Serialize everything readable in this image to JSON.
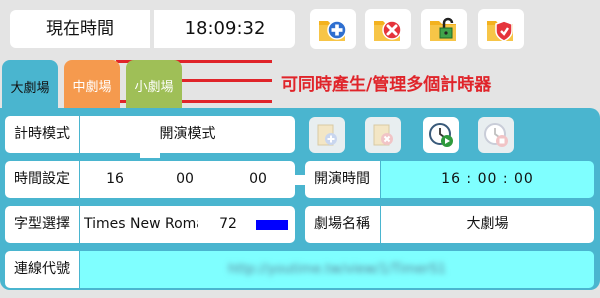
{
  "clock": {
    "label": "現在時間",
    "time": "18:09:32"
  },
  "toolbar": {
    "add_icon": "folder-plus-icon",
    "delete_icon": "folder-delete-icon",
    "unlock_icon": "folder-unlock-icon",
    "shield_icon": "folder-shield-icon"
  },
  "tabs": [
    {
      "label": "大劇場",
      "color": "#4ab5cf",
      "active": true
    },
    {
      "label": "中劇場",
      "color": "#f59a4e",
      "active": false
    },
    {
      "label": "小劇場",
      "color": "#9fbf57",
      "active": false
    }
  ],
  "annotation": "可同時產生/管理多個計時器",
  "annotation_color": "#e0242a",
  "form": {
    "mode_label": "計時模式",
    "mode_value": "開演模式",
    "time_label": "時間設定",
    "time_h": "16",
    "time_m": "00",
    "time_s": "00",
    "start_label": "開演時間",
    "start_value": "16 : 00 : 00",
    "font_label": "字型選擇",
    "font_value": "Times New Roman",
    "font_size": "72",
    "font_color": "#0000ff",
    "venue_label": "劇場名稱",
    "venue_value": "大劇場",
    "link_label": "連線代號",
    "link_value": "http://youtime.tw/view/1/TimerS1"
  },
  "panel_buttons": {
    "add_icon": "doc-add-icon",
    "delete_icon": "doc-delete-icon",
    "clock_play_icon": "clock-play-icon",
    "clock_stop_icon": "clock-stop-icon"
  },
  "colors": {
    "panel": "#4ab5cf",
    "highlight": "#7fffff",
    "background": "#e4e4e4"
  }
}
